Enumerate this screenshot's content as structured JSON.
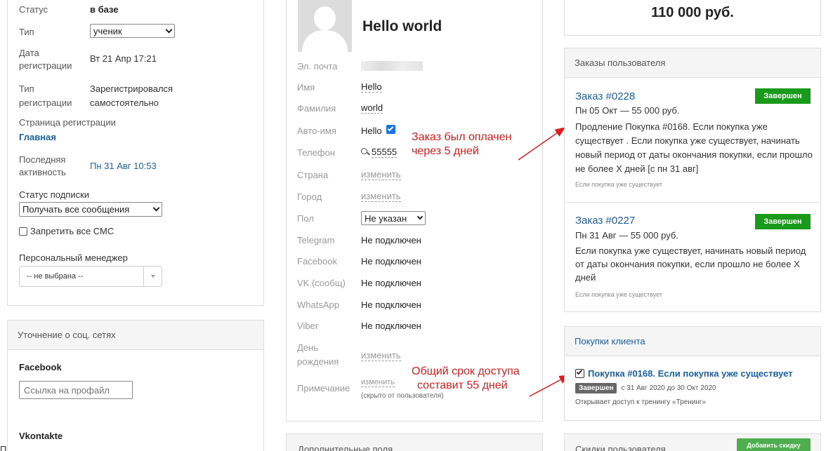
{
  "left": {
    "status_label": "Статус",
    "status_value": "в базе",
    "type_label": "Тип",
    "type_value": "ученик",
    "reg_date_label": "Дата регистрации",
    "reg_date_value": "Вт 21 Апр 17:21",
    "reg_type_label": "Тип регистрации",
    "reg_type_value": "Зарегистрировался самостоятельно",
    "reg_page_label": "Страница регистрации",
    "reg_page_value": "Главная",
    "last_activity_label": "Последняя активность",
    "last_activity_value": "Пн 31 Авг 10:53",
    "subscription_label": "Статус подписки",
    "subscription_value": "Получать все сообщения",
    "ban_sms_label": "Запретить все СМС",
    "manager_label": "Персональный менеджер",
    "manager_value": "-- не выбрана --"
  },
  "social": {
    "header": "Уточнение о соц. сетях",
    "facebook_label": "Facebook",
    "facebook_placeholder": "Ссылка на профайл",
    "vk_label": "Vkontakte",
    "cut_text": "П"
  },
  "profile": {
    "name": "Hello world",
    "fields": [
      {
        "label": "Эл. почта",
        "value": ""
      },
      {
        "label": "Имя",
        "value": "Hello"
      },
      {
        "label": "Фамилия",
        "value": "world"
      },
      {
        "label": "Авто-имя",
        "value": "Hello"
      },
      {
        "label": "Телефон",
        "value": "55555"
      },
      {
        "label": "Страна",
        "value": "изменить"
      },
      {
        "label": "Город",
        "value": "изменить"
      },
      {
        "label": "Пол",
        "value": "Не указан"
      },
      {
        "label": "Telegram",
        "value": "Не подключен"
      },
      {
        "label": "Facebook",
        "value": "Не подключен"
      },
      {
        "label": "VK (сообщ)",
        "value": "Не подключен"
      },
      {
        "label": "WhatsApp",
        "value": "Не подключен"
      },
      {
        "label": "Viber",
        "value": "Не подключен"
      },
      {
        "label": "День рождения",
        "value": "изменить"
      },
      {
        "label": "Примечание",
        "value": "изменить",
        "note": "(скрыто от пользователя)"
      }
    ],
    "extra_fields_header": "Дополнительные поля"
  },
  "annotations": {
    "paid": [
      "Заказ был оплачен",
      "через 5 дней"
    ],
    "term": [
      "Общий срок доступа",
      "составит 55 дней"
    ]
  },
  "right": {
    "total": "110 000 руб.",
    "orders_header": "Заказы пользователя",
    "orders": [
      {
        "title": "Заказ #0228",
        "badge": "Завершен",
        "meta": "Пн 05 Окт — 55 000 руб.",
        "desc": "Продление Покупка #0168. Если покупка уже существует . Если покупка уже существует, начинать новый период от даты окончания покупки, если прошло не более X дней [с пн 31 авг]",
        "sub": "Если покупка уже существует"
      },
      {
        "title": "Заказ #0227",
        "badge": "Завершен",
        "meta": "Пн 31 Авг — 55 000 руб.",
        "desc": "Если покупка уже существует, начинать новый период от даты окончания покупки, если прошло не более X дней",
        "sub": "Если покупка уже существует"
      }
    ],
    "purchases_header": "Покупки клиента",
    "purchase_title": "Покупка #0168. Если покупка уже существует",
    "purchase_badge": "Завершен",
    "purchase_dates": "с 31 Авг 2020 до 30 Окт 2020",
    "purchase_access": "Открывает доступ к тренингу «Тренинг»",
    "discounts_header": "Скидки пользователя",
    "add_discount": "Добавить скидку"
  },
  "colors": {
    "link": "#1a5fa8",
    "green": "#1a9a1a",
    "annotation": "#e01b1b"
  }
}
